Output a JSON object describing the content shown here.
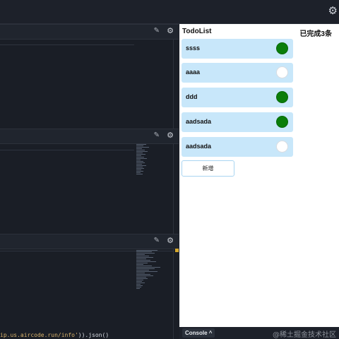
{
  "topbar": {
    "settings_icon": "gear-icon"
  },
  "panels": [
    {
      "link_icon": "pencil-link-icon",
      "settings_icon": "gear-icon"
    },
    {
      "link_icon": "pencil-link-icon",
      "settings_icon": "gear-icon"
    },
    {
      "link_icon": "pencil-link-icon",
      "settings_icon": "gear-icon"
    }
  ],
  "editor": {
    "code_fragment_string": "ip.us.aircode.run/info'",
    "code_fragment_rest": ")).json()"
  },
  "todo": {
    "title": "TodoList",
    "summary": "已完成3条",
    "items": [
      {
        "label": "ssss",
        "done": true
      },
      {
        "label": "aaaa",
        "done": false
      },
      {
        "label": "ddd",
        "done": true
      },
      {
        "label": "aadsada",
        "done": true
      },
      {
        "label": "aadsada",
        "done": false
      }
    ],
    "add_button": "新增"
  },
  "console": {
    "label": "Console",
    "chevron": "^"
  },
  "watermark": "@稀土掘金技术社区",
  "colors": {
    "done": "#0a7e0a",
    "item_bg": "#c8e7fa",
    "editor_bg": "#1a1e26"
  }
}
